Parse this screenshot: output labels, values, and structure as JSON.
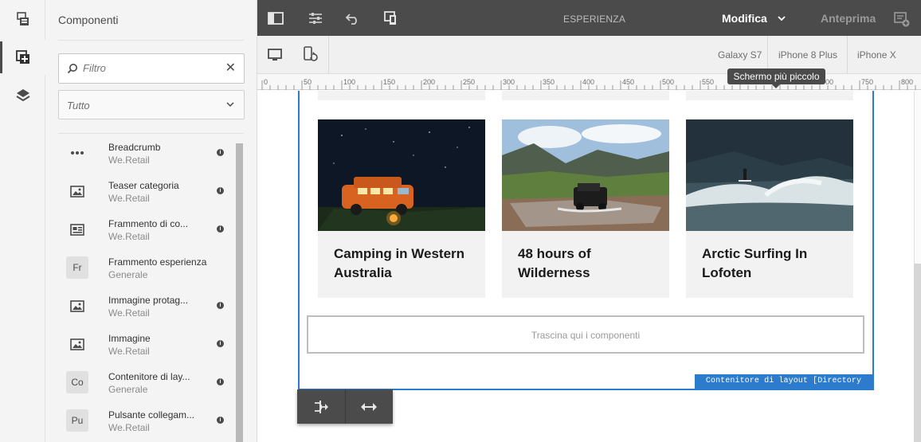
{
  "rail": {
    "icons": [
      "page-icon",
      "add-component-icon",
      "layers-icon"
    ]
  },
  "panel": {
    "title": "Componenti",
    "filter_placeholder": "Filtro",
    "select_value": "Tutto",
    "items": [
      {
        "name": "Breadcrumb",
        "group": "We.Retail",
        "icon": "ellipsis-icon"
      },
      {
        "name": "Teaser categoria",
        "group": "We.Retail",
        "icon": "image-icon"
      },
      {
        "name": "Frammento di co...",
        "group": "We.Retail",
        "icon": "content-fragment-icon"
      },
      {
        "name": "Frammento esperienza",
        "group": "Generale",
        "abbr": "Fr"
      },
      {
        "name": "Immagine protag...",
        "group": "We.Retail",
        "icon": "image-icon"
      },
      {
        "name": "Immagine",
        "group": "We.Retail",
        "icon": "image-icon"
      },
      {
        "name": "Contenitore di lay...",
        "group": "Generale",
        "abbr": "Co"
      },
      {
        "name": "Pulsante collegam...",
        "group": "We.Retail",
        "abbr": "Pu"
      }
    ]
  },
  "topbar": {
    "center_label": "ESPERIENZA",
    "mode_label": "Modifica",
    "preview_label": "Anteprima"
  },
  "emulator": {
    "devices": [
      "Galaxy S7",
      "iPhone 8 Plus",
      "iPhone X"
    ],
    "tooltip": "Schermo più piccolo"
  },
  "ruler": {
    "labels": [
      "0",
      "50",
      "100",
      "150",
      "200",
      "250",
      "300",
      "350",
      "400",
      "450",
      "500",
      "550",
      "600",
      "650",
      "700",
      "750",
      "800"
    ]
  },
  "content": {
    "cards": [
      {
        "title": "Camping in Western Australia"
      },
      {
        "title": "48 hours of Wilderness"
      },
      {
        "title": "Arctic Surfing In Lofoten"
      }
    ],
    "dropzone_label": "Trascina qui i componenti",
    "container_label": "Contenitore di layout [Directory principale]"
  },
  "colors": {
    "accent": "#2d7bcc",
    "topbar_bg": "#4b4b4b",
    "panel_bg": "#f4f4f4"
  }
}
